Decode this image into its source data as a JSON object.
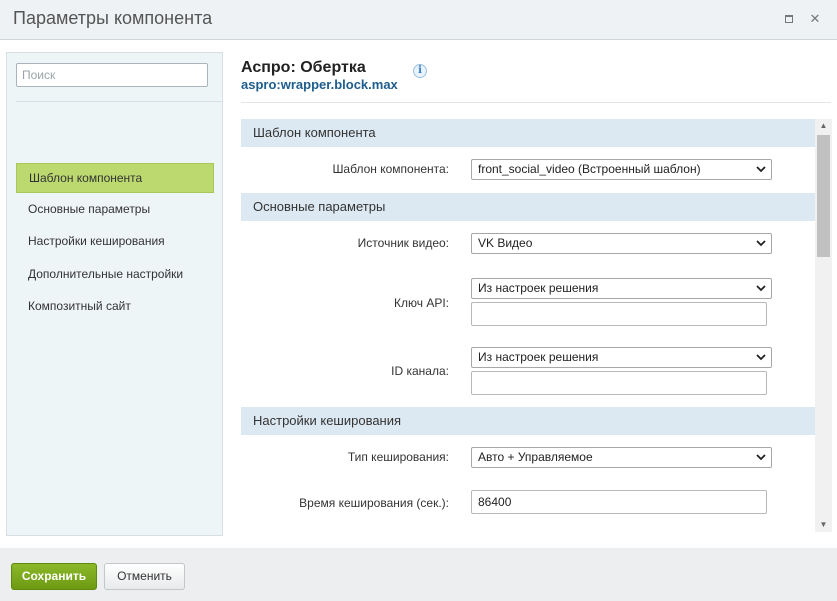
{
  "window": {
    "title": "Параметры компонента"
  },
  "sidebar": {
    "search_placeholder": "Поиск",
    "items": [
      {
        "label": "Шаблон компонента",
        "active": true
      },
      {
        "label": "Основные параметры",
        "active": false
      },
      {
        "label": "Настройки кеширования",
        "active": false
      },
      {
        "label": "Дополнительные настройки",
        "active": false
      },
      {
        "label": "Композитный сайт",
        "active": false
      }
    ]
  },
  "component": {
    "title": "Аспро: Обертка",
    "code": "aspro:wrapper.block.max",
    "info_glyph": "i"
  },
  "sections": {
    "template": {
      "title": "Шаблон компонента",
      "template_label": "Шаблон компонента:",
      "template_value": "front_social_video (Встроенный шаблон)"
    },
    "main": {
      "title": "Основные параметры",
      "video_source_label": "Источник видео:",
      "video_source_value": "VK Видео",
      "api_key_label": "Ключ API:",
      "api_key_value": "Из настроек решения",
      "api_key_text": "",
      "channel_id_label": "ID канала:",
      "channel_id_value": "Из настроек решения",
      "channel_id_text": ""
    },
    "cache": {
      "title": "Настройки кеширования",
      "cache_type_label": "Тип кеширования:",
      "cache_type_value": "Авто + Управляемое",
      "cache_time_label": "Время кеширования (сек.):",
      "cache_time_value": "86400"
    }
  },
  "footer": {
    "save_label": "Сохранить",
    "cancel_label": "Отменить"
  },
  "colors": {
    "accent_green": "#8cb829",
    "active_nav": "#bcd96f",
    "section_header": "#dde9f2",
    "link_blue": "#1e5d8c"
  }
}
